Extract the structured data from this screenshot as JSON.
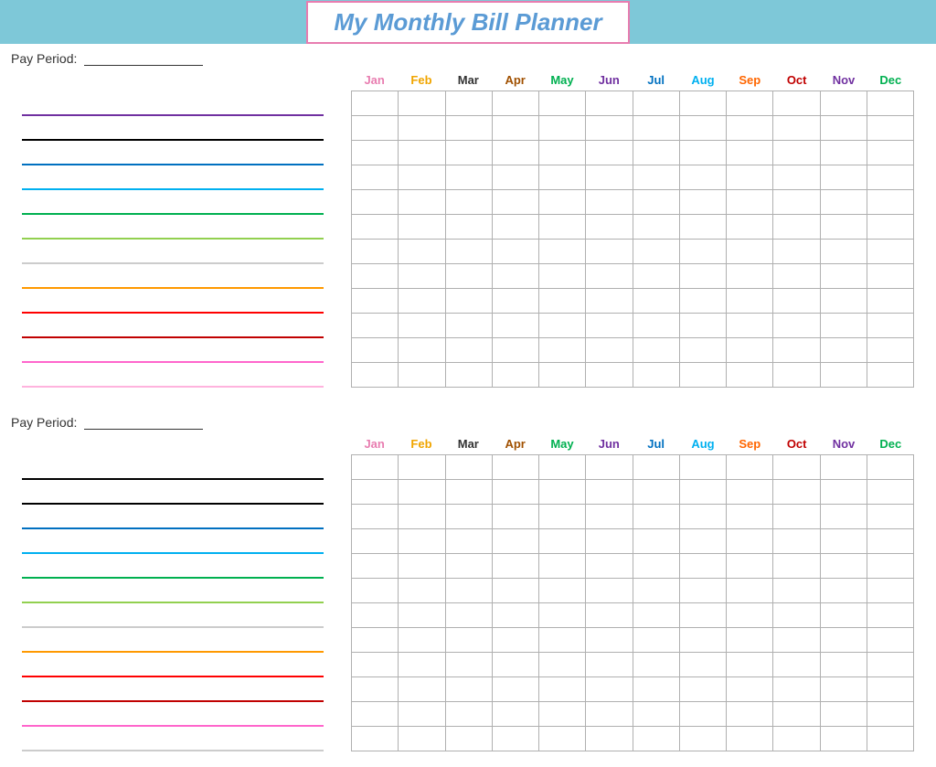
{
  "header": {
    "title": "My Monthly Bill Planner"
  },
  "months": [
    "Jan",
    "Feb",
    "Mar",
    "Apr",
    "May",
    "Jun",
    "Jul",
    "Aug",
    "Sep",
    "Oct",
    "Nov",
    "Dec"
  ],
  "monthClasses": [
    "m-jan",
    "m-feb",
    "m-mar",
    "m-apr",
    "m-may",
    "m-jun",
    "m-jul",
    "m-aug",
    "m-sep",
    "m-oct",
    "m-nov",
    "m-dec"
  ],
  "section1": {
    "payPeriodLabel": "Pay Period:",
    "rows": 12,
    "lineColors": [
      "color-purple",
      "color-black",
      "color-blue",
      "color-teal",
      "color-green",
      "color-ltgreen",
      "color-yellow",
      "color-orange",
      "color-red",
      "color-darkred",
      "color-pink",
      "color-ltpink"
    ]
  },
  "section2": {
    "payPeriodLabel": "Pay Period:",
    "rows": 12,
    "lineColors": [
      "color-black",
      "color-black",
      "color-blue",
      "color-teal",
      "color-green",
      "color-ltgreen",
      "color-yellow",
      "color-orange",
      "color-red",
      "color-darkred",
      "color-pink",
      "color-cyan"
    ]
  }
}
